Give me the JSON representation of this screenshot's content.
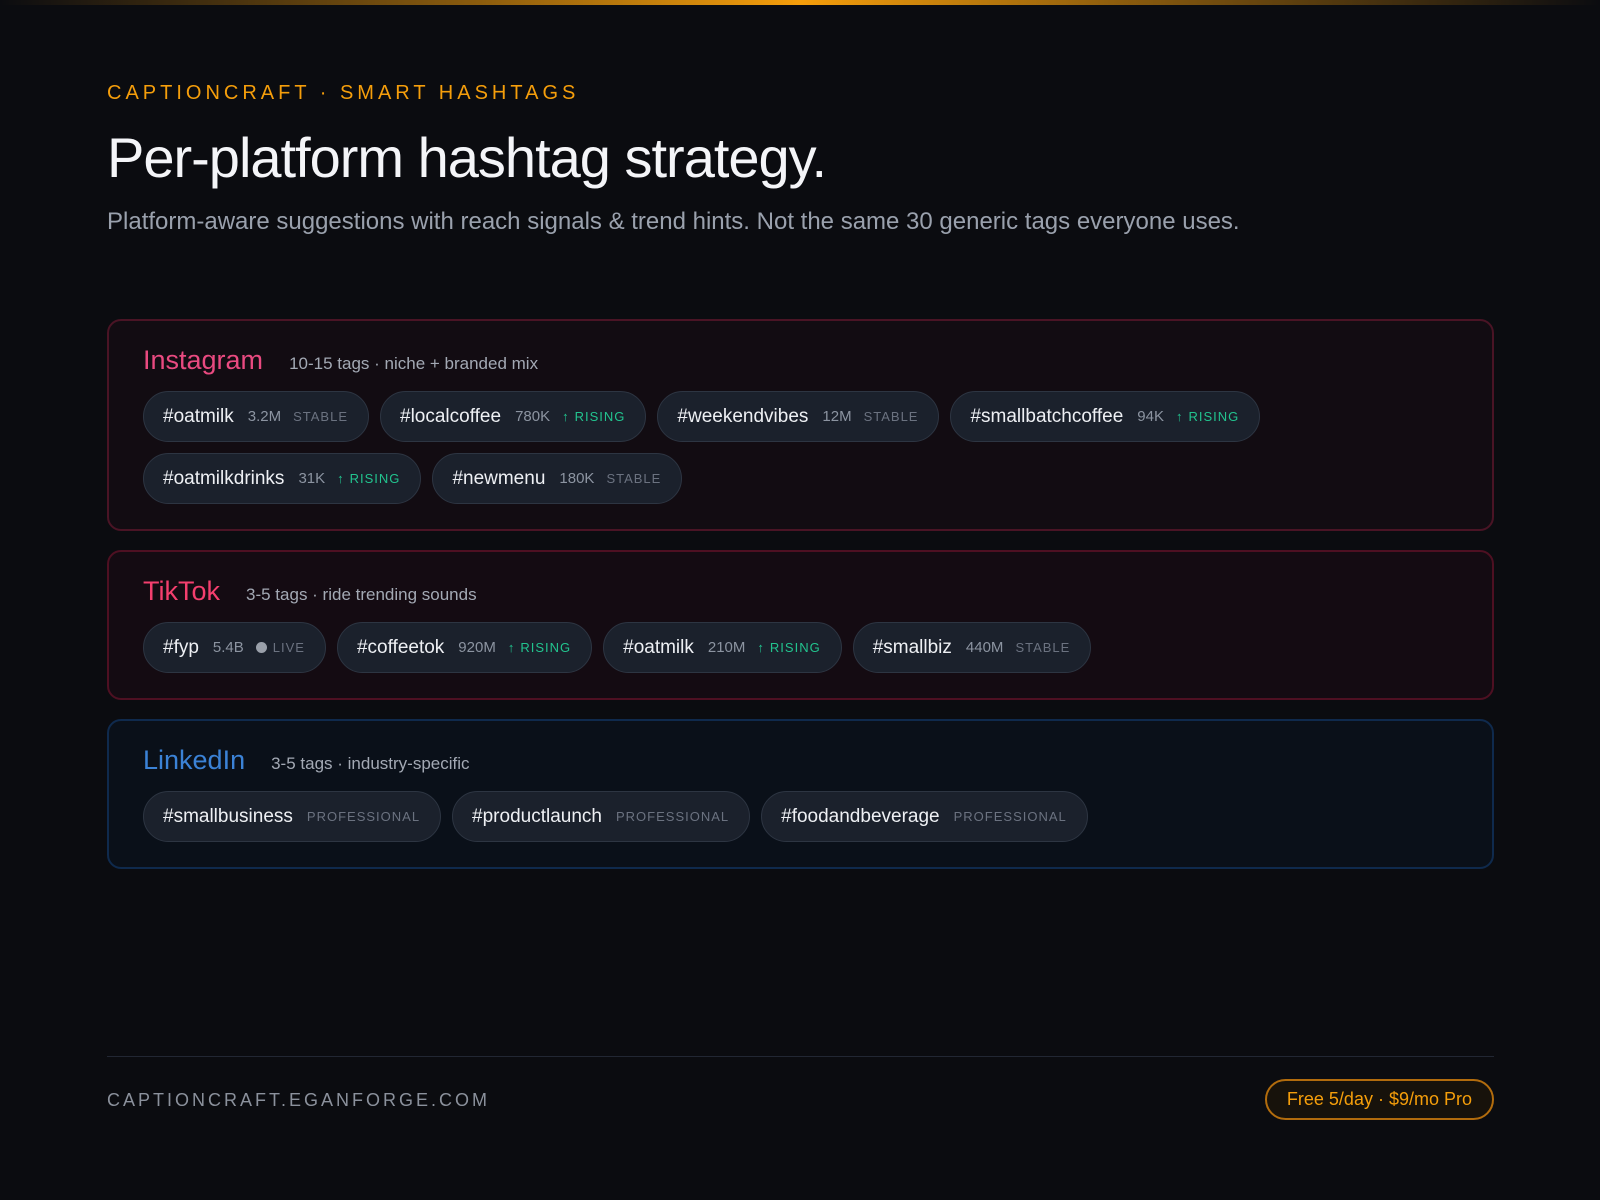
{
  "header": {
    "eyebrow": "CAPTIONCRAFT · SMART HASHTAGS",
    "title": "Per-platform hashtag strategy.",
    "subtitle": "Platform-aware suggestions with reach signals & trend hints. Not the same 30 generic tags everyone uses."
  },
  "colors": {
    "accent": "#f59e0b",
    "instagram": "#e94a80",
    "tiktok": "#f43f6e",
    "linkedin": "#3b82d6",
    "rising": "#22c38e"
  },
  "platforms": [
    {
      "key": "instagram",
      "name": "Instagram",
      "hint": "10-15 tags · niche + branded mix",
      "tags": [
        {
          "tag": "#oatmilk",
          "reach": "3.2M",
          "status": "STABLE",
          "kind": "stable"
        },
        {
          "tag": "#localcoffee",
          "reach": "780K",
          "status": "RISING",
          "kind": "rising"
        },
        {
          "tag": "#weekendvibes",
          "reach": "12M",
          "status": "STABLE",
          "kind": "stable"
        },
        {
          "tag": "#smallbatchcoffee",
          "reach": "94K",
          "status": "RISING",
          "kind": "rising"
        },
        {
          "tag": "#oatmilkdrinks",
          "reach": "31K",
          "status": "RISING",
          "kind": "rising"
        },
        {
          "tag": "#newmenu",
          "reach": "180K",
          "status": "STABLE",
          "kind": "stable"
        }
      ]
    },
    {
      "key": "tiktok",
      "name": "TikTok",
      "hint": "3-5 tags · ride trending sounds",
      "tags": [
        {
          "tag": "#fyp",
          "reach": "5.4B",
          "status": "LIVE",
          "kind": "live"
        },
        {
          "tag": "#coffeetok",
          "reach": "920M",
          "status": "RISING",
          "kind": "rising"
        },
        {
          "tag": "#oatmilk",
          "reach": "210M",
          "status": "RISING",
          "kind": "rising"
        },
        {
          "tag": "#smallbiz",
          "reach": "440M",
          "status": "STABLE",
          "kind": "stable"
        }
      ]
    },
    {
      "key": "linkedin",
      "name": "LinkedIn",
      "hint": "3-5 tags · industry-specific",
      "tags": [
        {
          "tag": "#smallbusiness",
          "reach": "",
          "status": "PROFESSIONAL",
          "kind": "professional"
        },
        {
          "tag": "#productlaunch",
          "reach": "",
          "status": "PROFESSIONAL",
          "kind": "professional"
        },
        {
          "tag": "#foodandbeverage",
          "reach": "",
          "status": "PROFESSIONAL",
          "kind": "professional"
        }
      ]
    }
  ],
  "footer": {
    "url": "CAPTIONCRAFT.EGANFORGE.COM",
    "pricing": "Free 5/day · $9/mo Pro"
  }
}
